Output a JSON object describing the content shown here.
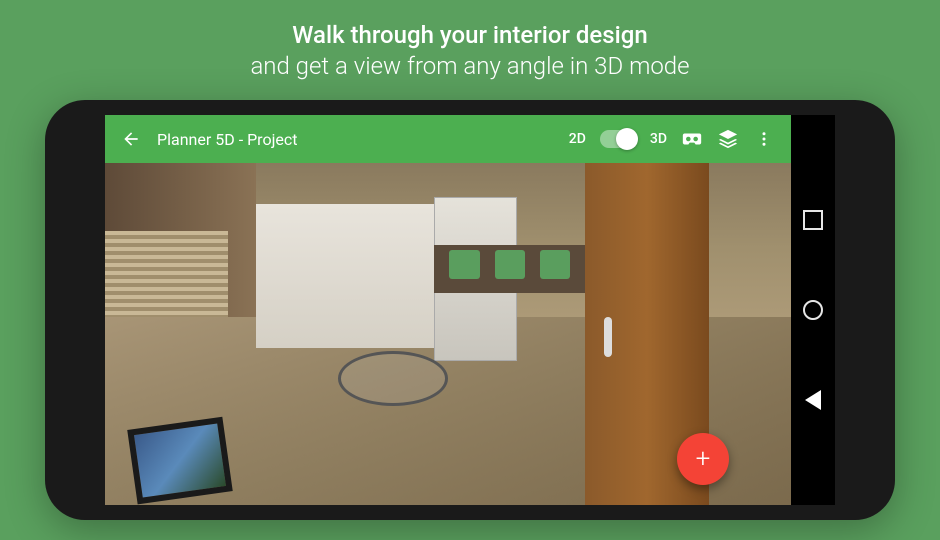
{
  "promo": {
    "title": "Walk through your interior design",
    "subtitle": "and get a view from any angle in 3D mode"
  },
  "app": {
    "title": "Planner 5D - Project",
    "view2d_label": "2D",
    "view3d_label": "3D",
    "toggle_state": "3D",
    "fab_label": "+"
  },
  "colors": {
    "background": "#5aa05e",
    "toolbar": "#4caf50",
    "fab": "#f44336"
  },
  "icons": {
    "back": "back-arrow-icon",
    "vr": "vr-headset-icon",
    "layers": "layers-icon",
    "overflow": "overflow-menu-icon",
    "nav_recent": "square-icon",
    "nav_home": "circle-icon",
    "nav_back": "triangle-icon"
  }
}
